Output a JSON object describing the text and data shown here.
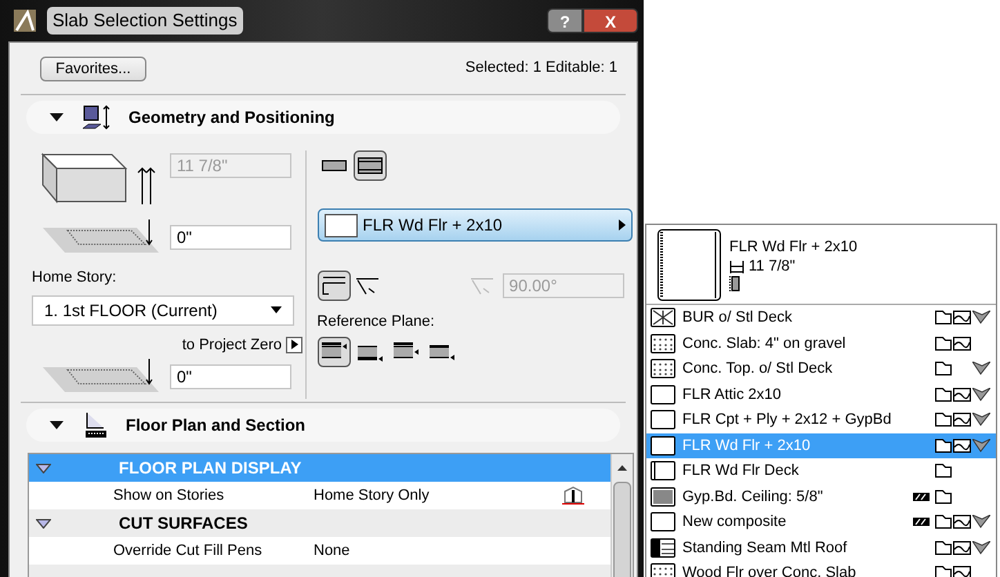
{
  "window": {
    "title": "Slab Selection Settings",
    "help": "?",
    "close": "X"
  },
  "toolbar": {
    "favorites": "Favorites...",
    "selection_info": "Selected: 1 Editable: 1"
  },
  "geometry": {
    "title": "Geometry and Positioning",
    "expanded": true,
    "thickness": "11 7/8\"",
    "offset": "0\"",
    "home_story_label": "Home Story:",
    "home_story": "1. 1st FLOOR (Current)",
    "to_project_zero": "to Project Zero",
    "elevation": "0\"",
    "structure": [
      {
        "selected": false
      },
      {
        "selected": true
      }
    ],
    "composite": "FLR Wd Flr + 2x10",
    "edge": [
      {
        "selected": true
      },
      {
        "selected": false
      }
    ],
    "angle": "90.00°",
    "reference_plane_label": "Reference Plane:",
    "reference_plane": [
      {
        "selected": true
      },
      {
        "selected": false
      },
      {
        "selected": false
      },
      {
        "selected": false
      }
    ]
  },
  "floor_plan": {
    "title": "Floor Plan and Section",
    "expanded": true,
    "rows": [
      {
        "kind": "group",
        "label": "FLOOR PLAN DISPLAY",
        "selected": true
      },
      {
        "kind": "item",
        "label": "Show on Stories",
        "value": "Home Story Only",
        "icon": true
      },
      {
        "kind": "group",
        "label": "CUT SURFACES",
        "selected": false
      },
      {
        "kind": "item",
        "label": "Override Cut Fill Pens",
        "value": "None",
        "icon": false
      }
    ]
  },
  "composite_popup": {
    "preview_name": "FLR Wd Flr + 2x10",
    "preview_thickness": "11 7/8\"",
    "items": [
      {
        "name": "BUR o/ Stl Deck",
        "kind": "cross",
        "selected": false,
        "stripe": false,
        "fold": true,
        "hills": true,
        "wing": true
      },
      {
        "name": "Conc. Slab: 4\" on gravel",
        "kind": "dots",
        "selected": false,
        "stripe": false,
        "fold": true,
        "hills": true,
        "wing": false
      },
      {
        "name": "Conc. Top. o/ Stl Deck",
        "kind": "dots",
        "selected": false,
        "stripe": false,
        "fold": true,
        "hills": false,
        "wing": true
      },
      {
        "name": "FLR Attic 2x10",
        "kind": "blank",
        "selected": false,
        "stripe": false,
        "fold": true,
        "hills": true,
        "wing": true
      },
      {
        "name": "FLR Cpt + Ply + 2x12 + GypBd",
        "kind": "blank",
        "selected": false,
        "stripe": false,
        "fold": true,
        "hills": true,
        "wing": true
      },
      {
        "name": "FLR Wd Flr + 2x10",
        "kind": "blank",
        "selected": true,
        "stripe": false,
        "fold": true,
        "hills": true,
        "wing": true
      },
      {
        "name": "FLR Wd Flr Deck",
        "kind": "edge",
        "selected": false,
        "stripe": false,
        "fold": true,
        "hills": false,
        "wing": false
      },
      {
        "name": "Gyp.Bd. Ceiling: 5/8\"",
        "kind": "dense",
        "selected": false,
        "stripe": true,
        "fold": true,
        "hills": false,
        "wing": false
      },
      {
        "name": "New composite",
        "kind": "blank",
        "selected": false,
        "stripe": true,
        "fold": true,
        "hills": true,
        "wing": true
      },
      {
        "name": "Standing Seam Mtl Roof",
        "kind": "dark",
        "selected": false,
        "stripe": false,
        "fold": true,
        "hills": true,
        "wing": true
      },
      {
        "name": "Wood Flr over Conc. Slab",
        "kind": "dots",
        "selected": false,
        "stripe": false,
        "fold": true,
        "hills": true,
        "wing": false
      }
    ]
  }
}
